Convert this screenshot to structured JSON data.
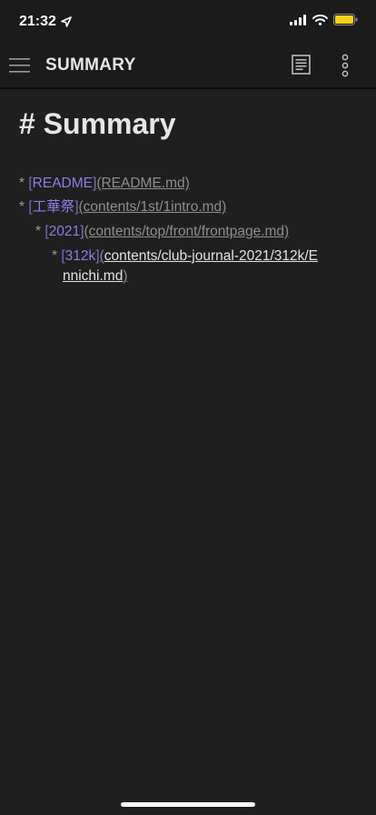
{
  "status": {
    "time": "21:32"
  },
  "app_bar": {
    "title": "SUMMARY"
  },
  "document": {
    "heading": "# Summary",
    "items": [
      {
        "bullet": "*",
        "open": "[",
        "text": "README",
        "close": "]",
        "url": "(README.md)"
      },
      {
        "bullet": "*",
        "open": "[",
        "text": "工華祭",
        "close": "]",
        "url": "(contents/1st/1intro.md)"
      },
      {
        "bullet": "*",
        "open": "[",
        "text": "2021",
        "close": "]",
        "url": "(contents/top/front/frontpage.md)"
      },
      {
        "bullet": "*",
        "open": "[",
        "text": "312k",
        "close": "]",
        "url_line1": "contents/club-journal-2021/312k/E",
        "url_line2": "nnichi.md",
        "paren_open": "(",
        "paren_close": ")"
      }
    ]
  },
  "colors": {
    "background": "#1f1f1f",
    "link": "#8c7ee8"
  },
  "icons": [
    "location-arrow-icon",
    "signal-icon",
    "wifi-icon",
    "battery-icon",
    "menu-icon",
    "document-icon",
    "more-vertical-icon"
  ]
}
